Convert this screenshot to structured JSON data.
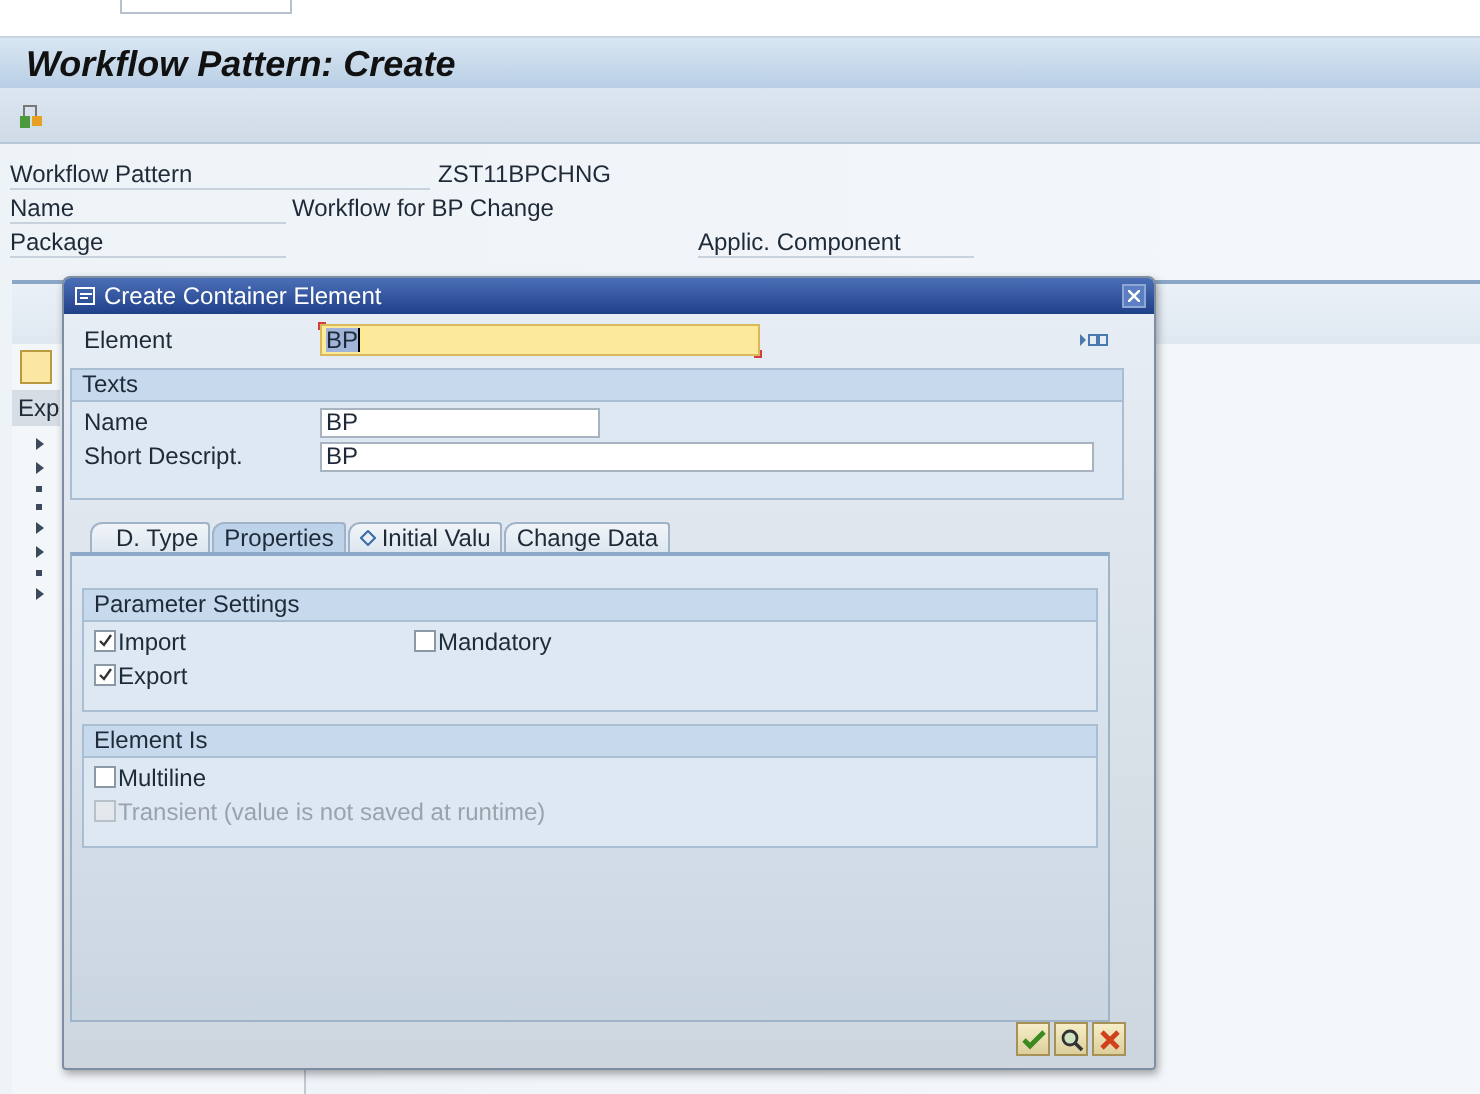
{
  "window": {
    "title": "Workflow Pattern: Create"
  },
  "header_fields": [
    {
      "label": "Workflow Pattern",
      "value": "ZST11BPCHNG"
    },
    {
      "label": "Name",
      "value": "Workflow for BP Change"
    },
    {
      "label": "Package",
      "side_label": "Applic. Component"
    }
  ],
  "background_panel": {
    "column_header": "Exp"
  },
  "dialog": {
    "title": "Create Container Element",
    "element": {
      "label": "Element",
      "value": "BP"
    },
    "texts_group": {
      "title": "Texts",
      "fields": [
        {
          "label": "Name",
          "value": "BP",
          "kind": "short"
        },
        {
          "label": "Short Descript.",
          "value": "BP",
          "kind": "long"
        }
      ]
    },
    "tabs": [
      {
        "label": "D. Type",
        "selected": false,
        "kind": "plain"
      },
      {
        "label": "Properties",
        "selected": true,
        "kind": "plain"
      },
      {
        "label": "Initial Valu",
        "selected": false,
        "kind": "diamond"
      },
      {
        "label": "Change Data",
        "selected": false,
        "kind": "plain"
      }
    ],
    "groups": [
      {
        "title": "Parameter Settings",
        "options": [
          {
            "label": "Import",
            "checked": true,
            "disabled": false
          },
          {
            "label": "Mandatory",
            "checked": false,
            "disabled": false
          },
          {
            "label": "Export",
            "checked": true,
            "disabled": false
          }
        ]
      },
      {
        "title": "Element Is",
        "options": [
          {
            "label": "Multiline",
            "checked": false,
            "disabled": false
          },
          {
            "label": "Transient (value is not saved at runtime)",
            "checked": false,
            "disabled": true
          }
        ]
      }
    ],
    "buttons": [
      {
        "kind": "confirm"
      },
      {
        "kind": "inspect"
      },
      {
        "kind": "cancel"
      }
    ]
  }
}
